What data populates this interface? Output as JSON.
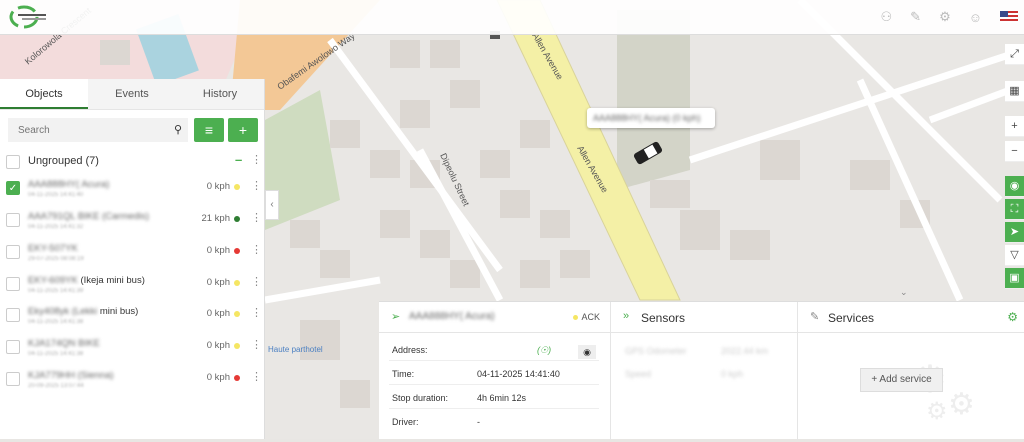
{
  "map": {
    "streets": [
      "Kolorowola Crescent",
      "Obafemi Awolowo Way",
      "Allen Avenue",
      "Allen Avenue",
      "Dipeolu Street"
    ],
    "poi": "Haute parthotel",
    "vehicle_popup": "AAA888HY( Acura) (0 kph)"
  },
  "tabs": [
    "Objects",
    "Events",
    "History"
  ],
  "search": {
    "placeholder": "Search"
  },
  "group": {
    "label": "Ungrouped (7)"
  },
  "objects": [
    {
      "name_hidden": "AAA888HY( Acura)",
      "sub": "04-11-2025 14:41:40",
      "speed": "0 kph",
      "status_color": "#f5e663",
      "checked": true
    },
    {
      "name_hidden": "AAA791QL BIKE (Carmedis)",
      "sub": "04-11-2025 14:41:32",
      "speed": "21 kph",
      "status_color": "#2e7d32",
      "checked": false
    },
    {
      "name_hidden": "EKY-507YK",
      "sub": "29-07-2025 08:08:19",
      "speed": "0 kph",
      "status_color": "#e53935",
      "checked": false
    },
    {
      "name_hidden": "EKY-609YK",
      "name_visible": "(Ikeja mini bus)",
      "sub": "04-11-2025 14:41:39",
      "speed": "0 kph",
      "status_color": "#f5e663",
      "checked": false
    },
    {
      "name_hidden": "Eky408yk (Lekki",
      "name_visible": "mini bus)",
      "sub": "04-11-2025 14:41:38",
      "speed": "0 kph",
      "status_color": "#f5e663",
      "checked": false
    },
    {
      "name_hidden": "KJA174QN BIKE",
      "sub": "04-11-2025 14:41:38",
      "speed": "0 kph",
      "status_color": "#f5e663",
      "checked": false
    },
    {
      "name_hidden": "KJA779HH (Sienna)",
      "sub": "20-09-2025 13:07:44",
      "speed": "0 kph",
      "status_color": "#e53935",
      "checked": false
    }
  ],
  "details": {
    "title_hidden": "AAA888HY( Acura)",
    "ack": "ACK",
    "rows": [
      {
        "k": "Address:",
        "v": ""
      },
      {
        "k": "Time:",
        "v": "04-11-2025 14:41:40"
      },
      {
        "k": "Stop duration:",
        "v": "4h 6min 12s"
      },
      {
        "k": "Driver:",
        "v": "-"
      }
    ]
  },
  "sensors": {
    "title": "Sensors",
    "rows": [
      "GPS Odometer",
      "Speed"
    ],
    "values": [
      "2022.44 km",
      "0 kph"
    ]
  },
  "services": {
    "title": "Services",
    "add_label": "Add service"
  },
  "colors": {
    "accent": "#4caf50",
    "road_yellow": "#f4f0a6",
    "road_orange": "#f3c896"
  }
}
